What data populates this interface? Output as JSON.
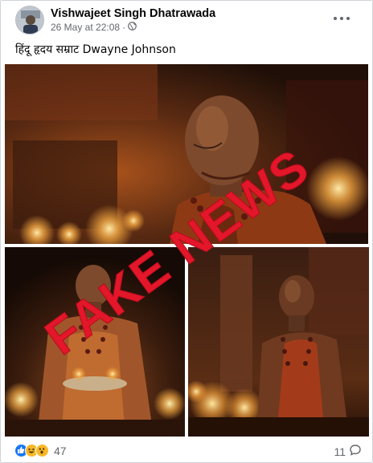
{
  "post": {
    "author": "Vishwajeet Singh Dhatrawada",
    "date": "26 May at 22:08",
    "separator": "·",
    "audience_icon": "globe-icon",
    "more_icon": "more-options-icon",
    "caption": "हिंदू हृदय सम्राट Dwayne Johnson"
  },
  "photos": [
    {
      "name": "photo-top",
      "description_icon": "photo"
    },
    {
      "name": "photo-bottom-left",
      "description_icon": "photo"
    },
    {
      "name": "photo-bottom-right",
      "description_icon": "photo"
    }
  ],
  "overlay": {
    "stamp_text": "FAKE NEWS",
    "color": "#e3162a"
  },
  "footer": {
    "reactions": [
      "like-icon",
      "haha-icon",
      "wow-icon"
    ],
    "reaction_count": "47",
    "comment_count": "11",
    "comment_icon": "comment-icon"
  },
  "colors": {
    "text_primary": "#050505",
    "text_secondary": "#65676b",
    "like_blue": "#1877f2",
    "reaction_yellow": "#f7b928"
  }
}
